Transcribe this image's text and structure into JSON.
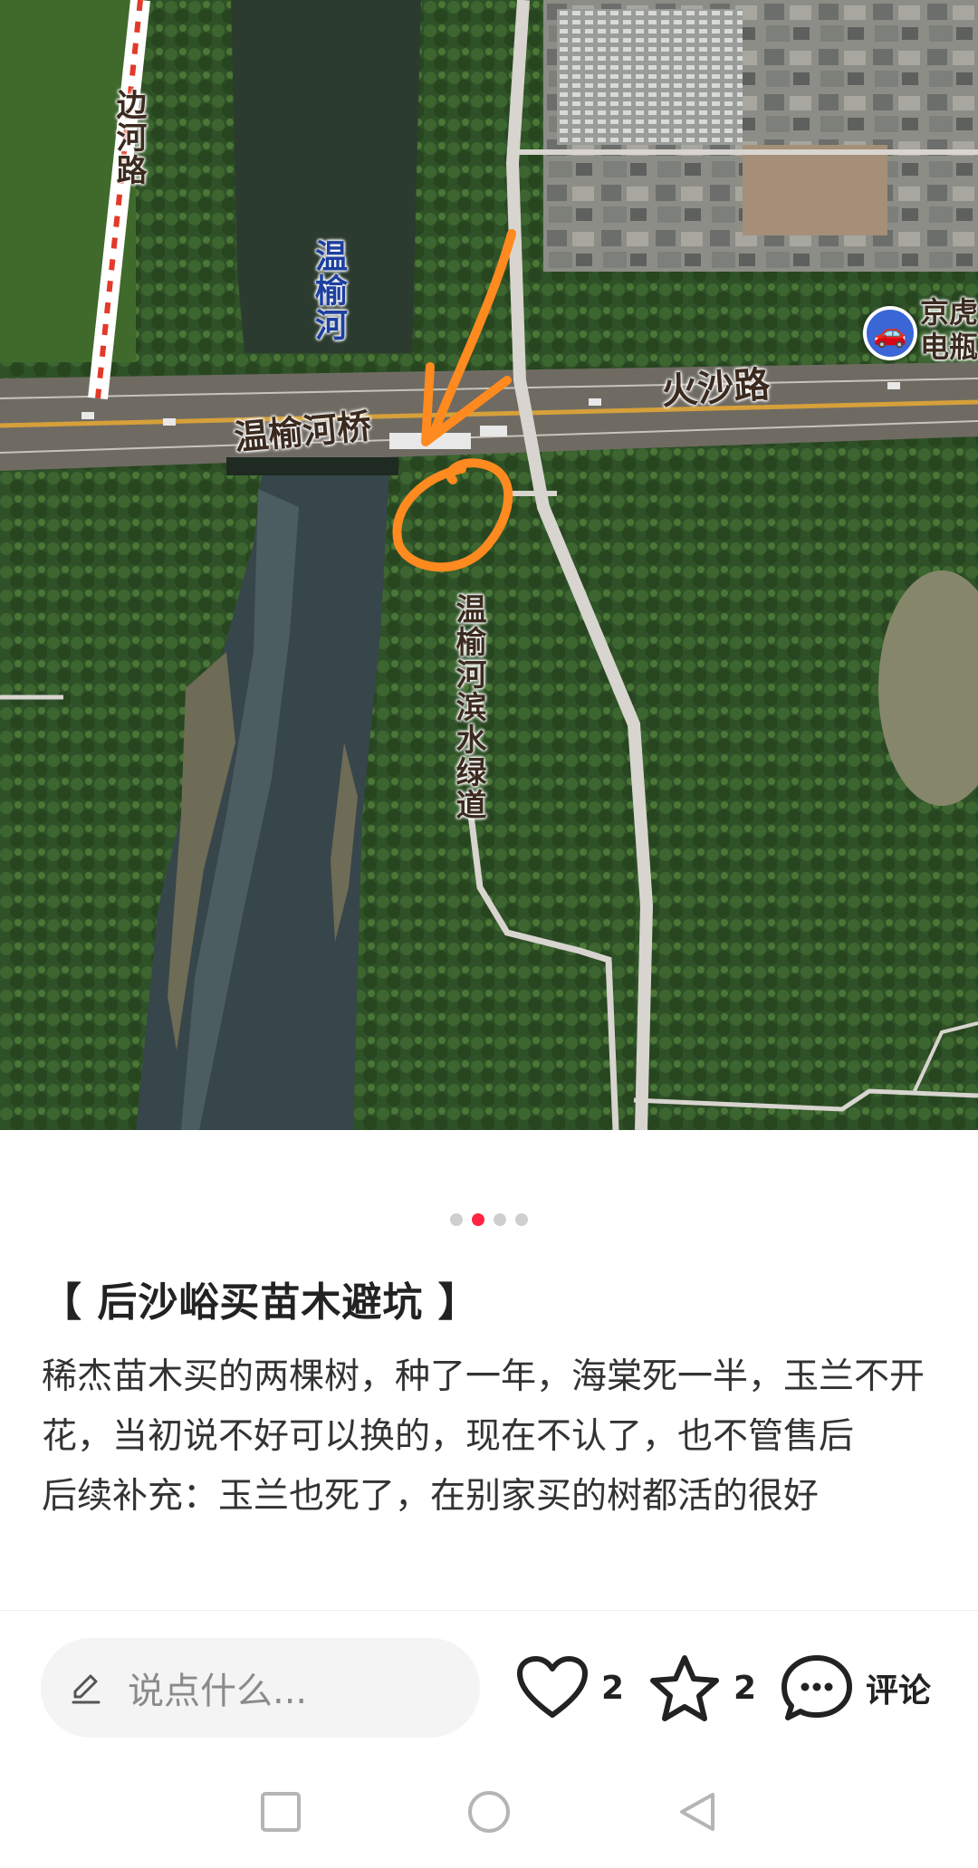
{
  "map": {
    "labels": {
      "bian_he_lu": "边河路",
      "wen_yu_he": "温榆河",
      "huo_sha_lu": "火沙路",
      "bridge": "温榆河桥",
      "greenway": "温榆河滨水绿道",
      "poi": "京虎\n电瓶"
    },
    "icons": {
      "poi_icon": "car-icon",
      "annotation_arrow": "arrow-annotation",
      "annotation_circle": "circle-annotation"
    },
    "colors": {
      "annotation": "#ff8a1f",
      "red_dashed_road": "#e23a2a",
      "road": "#d8d4cf"
    }
  },
  "carousel": {
    "count": 4,
    "active_index": 1,
    "active_color": "#ff2442"
  },
  "post": {
    "title": "【 后沙峪买苗木避坑 】",
    "body_line_1": "稀杰苗木买的两棵树，种了一年，海棠死一半，玉兰不开花，当初说不好可以换的，现在不认了，也不管售后",
    "body_line_2": "后续补充：玉兰也死了，在别家买的树都活的很好"
  },
  "action_bar": {
    "comment_placeholder": "说点什么...",
    "like_count": "2",
    "collect_count": "2",
    "comment_label": "评论",
    "icons": {
      "pen": "pen-icon",
      "like": "heart-icon",
      "collect": "star-icon",
      "comment": "chat-bubble-icon"
    }
  },
  "system_nav": {
    "recent": "square-icon",
    "home": "circle-icon",
    "back": "triangle-back-icon"
  }
}
